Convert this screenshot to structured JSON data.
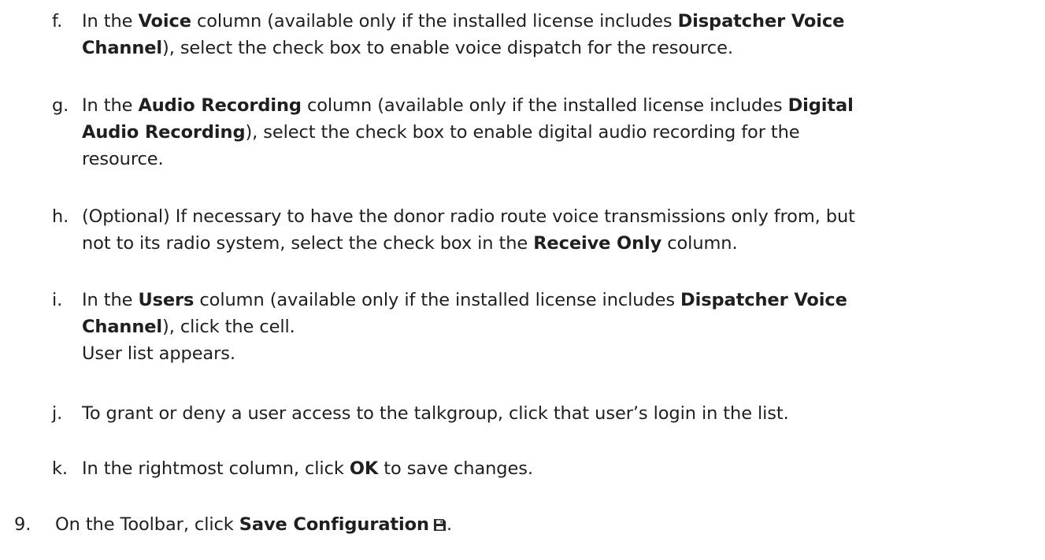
{
  "steps": [
    {
      "marker": "f.",
      "parts": [
        "In the ",
        "Voice",
        " column (available only if the installed license includes ",
        "Dispatcher Voice",
        "Channel",
        "), select the check box to enable voice dispatch for the resource."
      ]
    },
    {
      "marker": "g.",
      "parts": [
        "In the ",
        "Audio Recording",
        " column (available only if the installed license includes ",
        "Digital",
        "Audio Recording",
        "), select the check box to enable digital audio recording for the",
        "resource."
      ]
    },
    {
      "marker": "h.",
      "parts": [
        "(Optional) If necessary to have the donor radio route voice transmissions only from, but",
        "not to its radio system, select the check box in the ",
        "Receive Only",
        " column."
      ]
    },
    {
      "marker": "i.",
      "parts": [
        "In the ",
        "Users",
        " column (available only if the installed license includes ",
        "Dispatcher Voice",
        "Channel",
        "), click the cell.",
        "User list appears."
      ]
    },
    {
      "marker": "j.",
      "parts": [
        "To grant or deny a user access to the talkgroup, click that user’s login in the list."
      ]
    },
    {
      "marker": "k.",
      "parts": [
        "In the rightmost column, click ",
        "OK",
        " to save changes."
      ]
    },
    {
      "marker": "9.",
      "parts": [
        "On the Toolbar, click ",
        "Save Configuration",
        "."
      ],
      "icon": "save-icon"
    }
  ]
}
